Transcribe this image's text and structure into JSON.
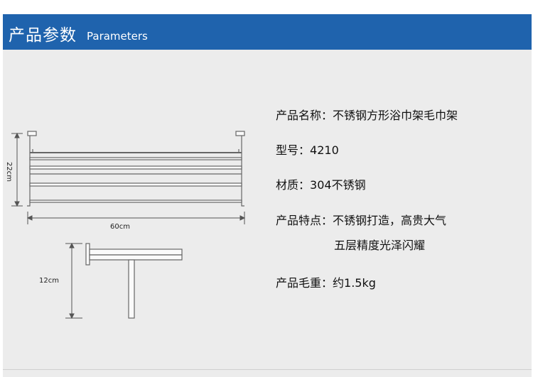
{
  "header": {
    "title_cn": "产品参数",
    "title_en": "Parameters"
  },
  "dimensions": {
    "height": "22cm",
    "width": "60cm",
    "depth": "12cm"
  },
  "specs": [
    {
      "label": "产品名称",
      "value": "不锈钢方形浴巾架毛巾架"
    },
    {
      "label": "型号",
      "value": "4210"
    },
    {
      "label": "材质",
      "value": "304不锈钢"
    },
    {
      "label": "产品特点",
      "value": "不锈钢打造，高贵大气"
    },
    {
      "label": "",
      "value": "五层精度光泽闪耀"
    },
    {
      "label": "产品毛重",
      "value": "约1.5kg"
    }
  ],
  "separator": "：",
  "colors": {
    "header_bg": "#1f63ad",
    "panel_bg": "#ececec",
    "line": "#555555"
  }
}
